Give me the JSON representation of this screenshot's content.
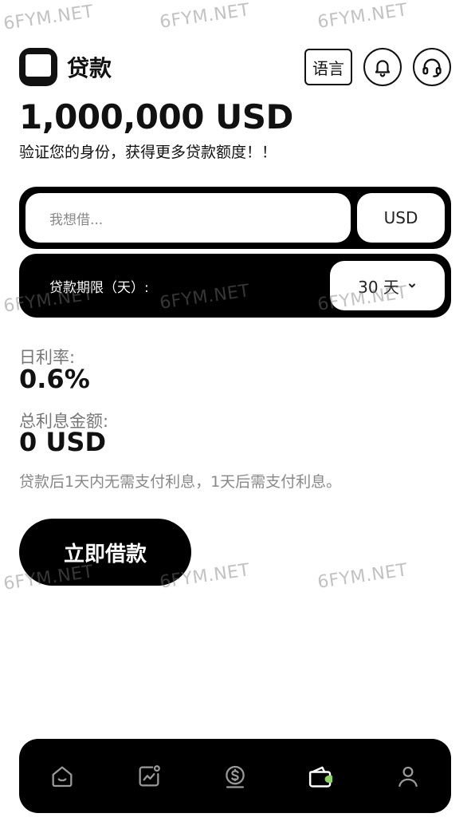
{
  "header": {
    "title": "贷款",
    "language_label": "语言",
    "notification_icon": "bell-icon",
    "support_icon": "headset-icon"
  },
  "loan": {
    "amount": "1,000,000 USD",
    "verify_text": "验证您的身份，获得更多贷款额度！！",
    "input_placeholder": "我想借...",
    "currency": "USD",
    "term_label": "贷款期限（天）:",
    "term_value": "30 天"
  },
  "rates": {
    "daily_rate_label": "日利率:",
    "daily_rate_value": "0.6%",
    "total_interest_label": "总利息金额:",
    "total_interest_value": "0 USD",
    "note": "贷款后1天内无需支付利息，1天后需支付利息。"
  },
  "actions": {
    "borrow_label": "立即借款"
  },
  "tabbar": {
    "items": [
      {
        "icon": "home-icon"
      },
      {
        "icon": "chart-icon"
      },
      {
        "icon": "coin-icon"
      },
      {
        "icon": "wallet-icon",
        "active": true
      },
      {
        "icon": "user-icon"
      }
    ],
    "active_color": "#8fd16a"
  },
  "watermark": "6FYM.NET"
}
